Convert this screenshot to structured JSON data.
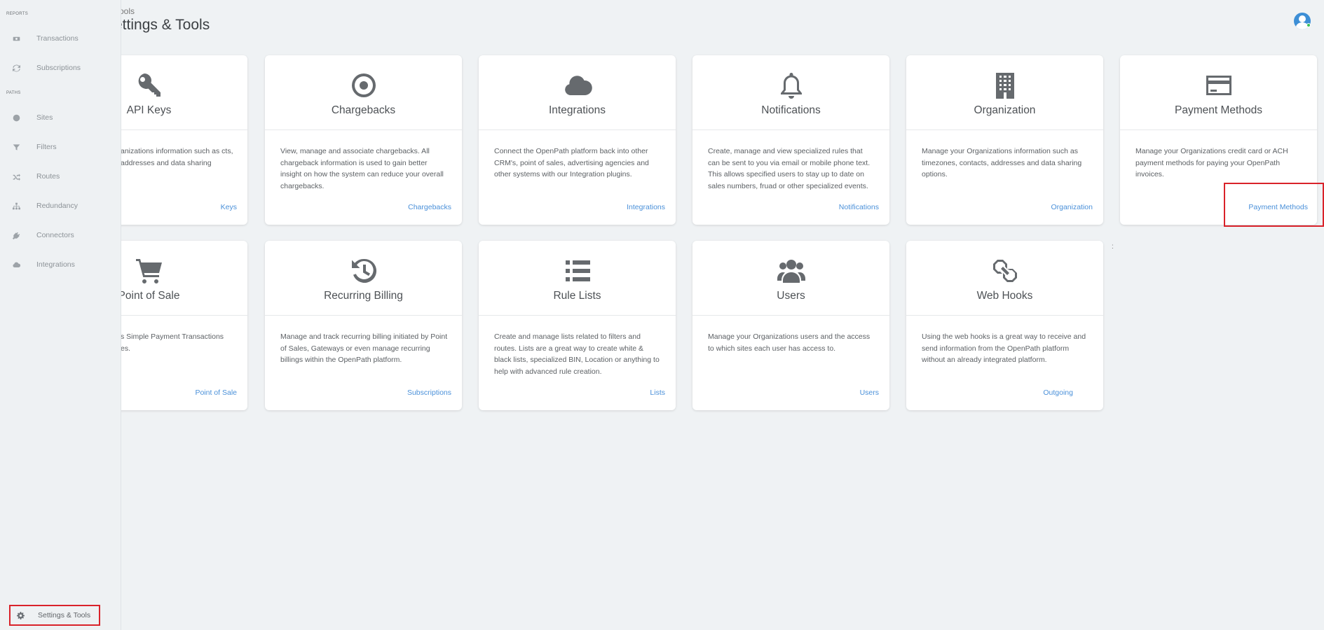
{
  "sidebar": {
    "sections": [
      {
        "label": "REPORTS"
      },
      {
        "label": "PATHS"
      }
    ],
    "items": [
      {
        "label": "Transactions",
        "icon": "money-icon"
      },
      {
        "label": "Subscriptions",
        "icon": "refresh-icon"
      },
      {
        "label": "Sites",
        "icon": "globe-icon"
      },
      {
        "label": "Filters",
        "icon": "filter-icon"
      },
      {
        "label": "Routes",
        "icon": "shuffle-icon"
      },
      {
        "label": "Redundancy",
        "icon": "sitemap-icon"
      },
      {
        "label": "Connectors",
        "icon": "plug-icon"
      },
      {
        "label": "Integrations",
        "icon": "cloud-icon"
      }
    ],
    "settings": {
      "label": "Settings & Tools",
      "icon": "gear-icon"
    }
  },
  "header": {
    "breadcrumb": "ools",
    "title": "ettings & Tools"
  },
  "cards": [
    {
      "title": "API Keys",
      "icon": "key-icon",
      "desc": "anizations information such as cts, addresses and data sharing",
      "link": "Keys"
    },
    {
      "title": "Chargebacks",
      "icon": "target-icon",
      "desc": "View, manage and associate chargebacks. All chargeback information is used to gain better insight on how the system can reduce your overall chargebacks.",
      "link": "Chargebacks"
    },
    {
      "title": "Integrations",
      "icon": "cloud-icon",
      "desc": "Connect the OpenPath platform back into other CRM's, point of sales, advertising agencies and other systems with our Integration plugins.",
      "link": "Integrations"
    },
    {
      "title": "Notifications",
      "icon": "bell-icon",
      "desc": "Create, manage and view specialized rules that can be sent to you via email or mobile phone text. This allows specified users to stay up to date on sales numbers, fruad or other specialized events.",
      "link": "Notifications"
    },
    {
      "title": "Organization",
      "icon": "building-icon",
      "desc": "Manage your Organizations information such as timezones, contacts, addresses and data sharing options.",
      "link": "Organization"
    },
    {
      "title": "Payment Methods",
      "icon": "credit-card-icon",
      "desc": "Manage your Organizations credit card or ACH payment methods for paying your OpenPath invoices.",
      "link": "Payment Methods"
    },
    {
      "title": "Point of Sale",
      "icon": "cart-icon",
      "desc": "s Simple Payment Transactions es.",
      "link": "Point of Sale"
    },
    {
      "title": "Recurring Billing",
      "icon": "history-icon",
      "desc": "Manage and track recurring billing initiated by Point of Sales, Gateways or even manage recurring billings within the OpenPath platform.",
      "link": "Subscriptions"
    },
    {
      "title": "Rule Lists",
      "icon": "list-icon",
      "desc": "Create and manage lists related to filters and routes. Lists are a great way to create white & black lists, specialized BIN, Location or anything to help with advanced rule creation.",
      "link": "Lists"
    },
    {
      "title": "Users",
      "icon": "users-icon",
      "desc": "Manage your Organizations users and the access to which sites each user has access to.",
      "link": "Users"
    },
    {
      "title": "Web Hooks",
      "icon": "link-icon",
      "desc": "Using the web hooks is a great way to receive and send information from the OpenPath platform without an already integrated platform.",
      "link": "Outgoing"
    }
  ],
  "colors": {
    "accent": "#4a90d9",
    "highlight": "#d9222a",
    "avatar": "#3d8fd6",
    "status": "#3bbf5a"
  }
}
